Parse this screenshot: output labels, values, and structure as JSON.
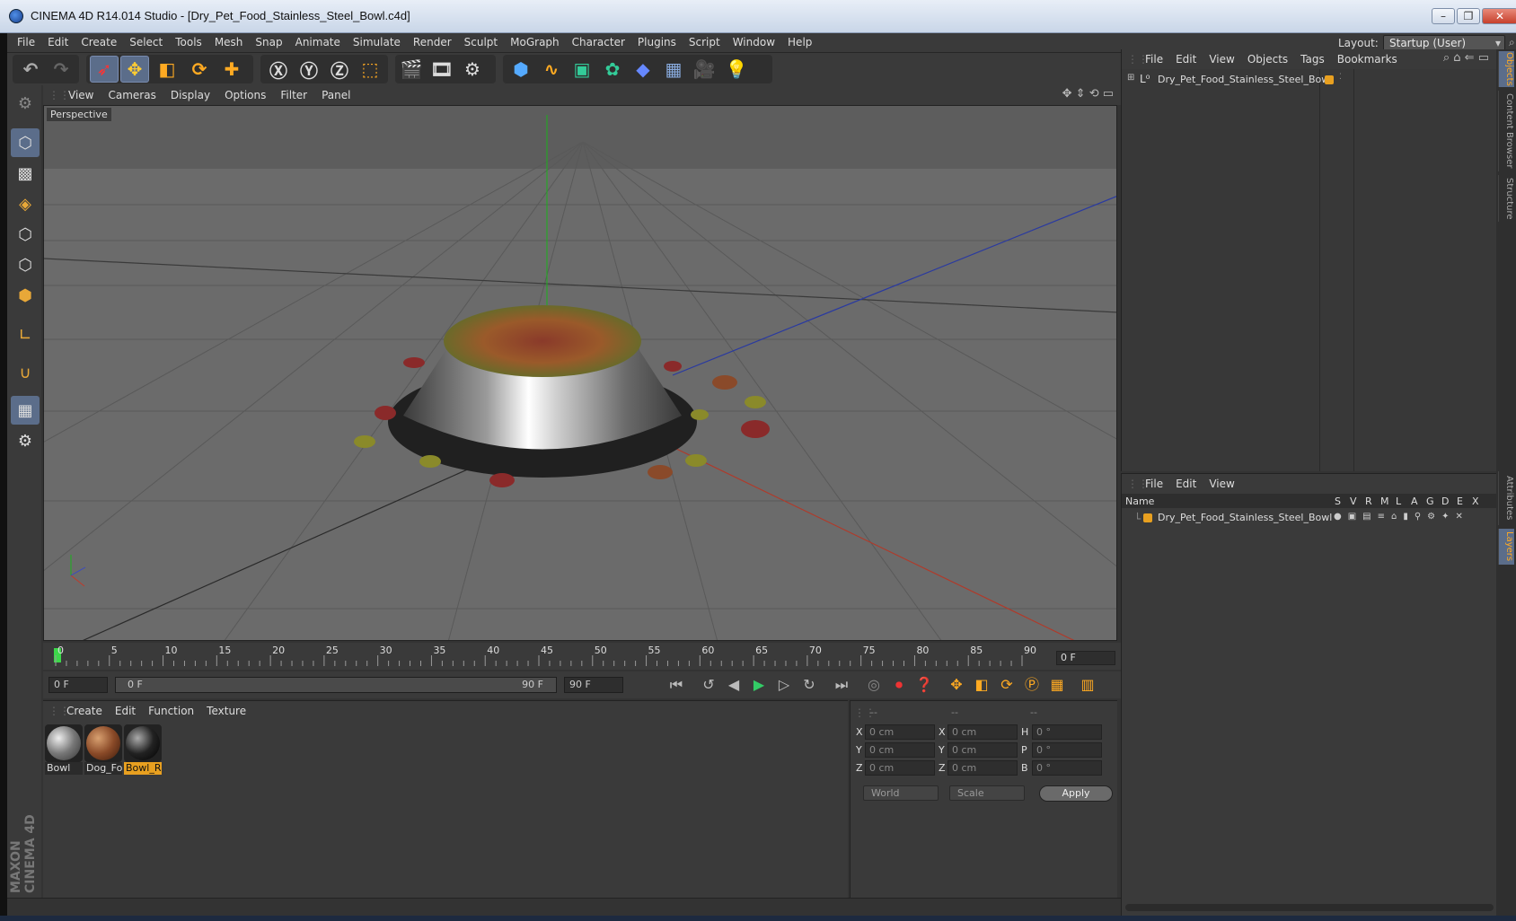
{
  "window": {
    "title": "CINEMA 4D R14.014 Studio - [Dry_Pet_Food_Stainless_Steel_Bowl.c4d]"
  },
  "menubar": {
    "items": [
      "File",
      "Edit",
      "Create",
      "Select",
      "Tools",
      "Mesh",
      "Snap",
      "Animate",
      "Simulate",
      "Render",
      "Sculpt",
      "MoGraph",
      "Character",
      "Plugins",
      "Script",
      "Window",
      "Help"
    ],
    "layout_label": "Layout:",
    "layout_value": "Startup (User)"
  },
  "viewport": {
    "menu": [
      "View",
      "Cameras",
      "Display",
      "Options",
      "Filter",
      "Panel"
    ],
    "label": "Perspective"
  },
  "timeline": {
    "ticks": [
      "0",
      "5",
      "10",
      "15",
      "20",
      "25",
      "30",
      "35",
      "40",
      "45",
      "50",
      "55",
      "60",
      "65",
      "70",
      "75",
      "80",
      "85",
      "90"
    ],
    "frame_readout": "0 F",
    "start_field": "0 F",
    "range_start": "0 F",
    "range_end": "90 F",
    "end_field": "90 F"
  },
  "material_manager": {
    "menu": [
      "Create",
      "Edit",
      "Function",
      "Texture"
    ],
    "materials": [
      {
        "label": "Bowl",
        "color": "#8a8a8a"
      },
      {
        "label": "Dog_Fo",
        "color": "#8a4a28"
      },
      {
        "label": "Bowl_Ri",
        "color": "#1a1a1a"
      }
    ]
  },
  "coordinates": {
    "headers": [
      "--",
      "--",
      "--"
    ],
    "rows": [
      {
        "l1": "X",
        "v1": "0 cm",
        "l2": "X",
        "v2": "0 cm",
        "l3": "H",
        "v3": "0 °"
      },
      {
        "l1": "Y",
        "v1": "0 cm",
        "l2": "Y",
        "v2": "0 cm",
        "l3": "P",
        "v3": "0 °"
      },
      {
        "l1": "Z",
        "v1": "0 cm",
        "l2": "Z",
        "v2": "0 cm",
        "l3": "B",
        "v3": "0 °"
      }
    ],
    "space": "World",
    "mode": "Scale",
    "apply": "Apply"
  },
  "object_manager": {
    "menu": [
      "File",
      "Edit",
      "View",
      "Objects",
      "Tags",
      "Bookmarks"
    ],
    "object_name": "Dry_Pet_Food_Stainless_Steel_Bowl"
  },
  "layer_manager": {
    "menu": [
      "File",
      "Edit",
      "View"
    ],
    "columns": [
      "Name",
      "S",
      "V",
      "R",
      "M",
      "L",
      "A",
      "G",
      "D",
      "E",
      "X"
    ],
    "layer_name": "Dry_Pet_Food_Stainless_Steel_Bowl"
  },
  "right_tabs": [
    "Objects",
    "Content Browser",
    "Structure",
    "Attributes",
    "Layers"
  ],
  "brand": "MAXON CINEMA 4D",
  "colors": {
    "accent": "#e8a020",
    "selected": "#5b6d8a"
  }
}
